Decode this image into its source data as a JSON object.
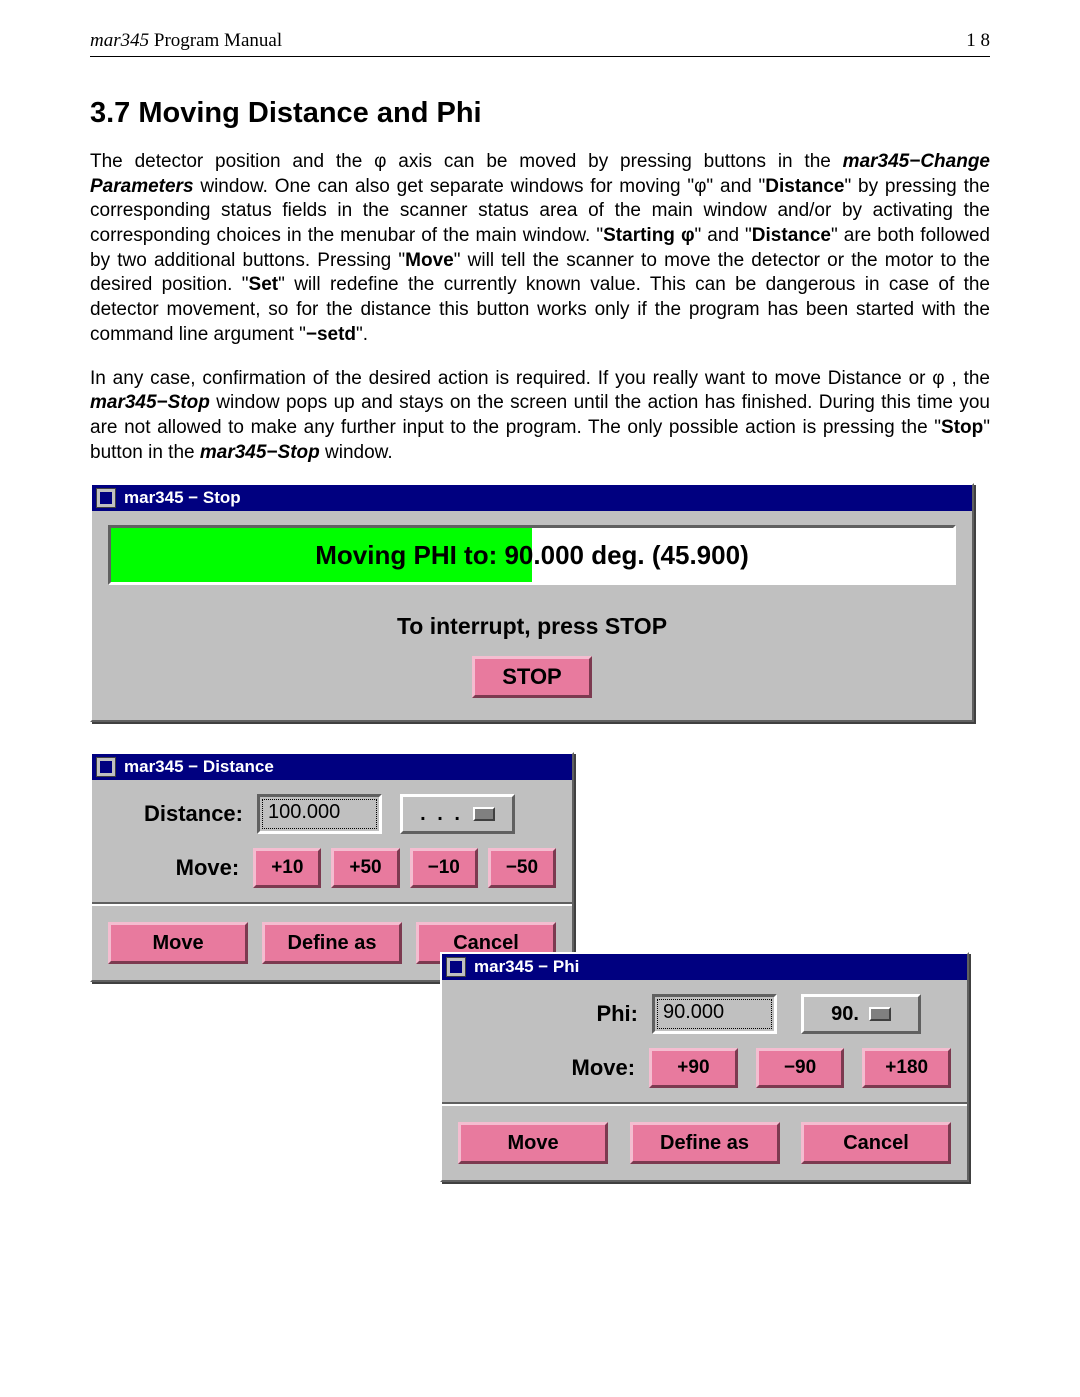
{
  "header": {
    "product": "mar345",
    "title_suffix": " Program Manual",
    "page_number": "1 8"
  },
  "section": {
    "heading": "3.7 Moving Distance and Phi"
  },
  "para1": {
    "t1": "The detector position and the φ axis can be moved by pressing buttons in the ",
    "bi1": "mar345−Change Parameters",
    "t2": " window. One can also get separate windows for moving \"φ\" and \"",
    "b1": "Distance",
    "t3": "\" by pressing the corresponding status fields in the scanner status area of the main  window and/or by activating the corresponding choices in the menubar of the main window. \"",
    "b2": "Starting φ",
    "t4": "\" and \"",
    "b3": "Distance",
    "t5": "\" are both followed by two additional buttons. Pressing \"",
    "b4": "Move",
    "t6": "\" will tell the scanner to move the detector or the motor to the desired position. \"",
    "b5": "Set",
    "t7": "\" will redefine the currently known value. This can be dangerous in case of the detector movement, so for the distance this button works only if the program has been started with the command line argument \"",
    "b6": "−setd",
    "t8": "\"."
  },
  "para2": {
    "t1": "In any case, confirmation of the desired action is required. If you really want to move Distance or φ , the ",
    "bi1": "mar345−Stop",
    "t2": " window pops up and stays on the screen until the action has finished. During this time you are not allowed to make any further input to the program. The only possible action is pressing the \"",
    "b1": "Stop",
    "t3": "\" button in the ",
    "bi2": "mar345−Stop",
    "t4": " window."
  },
  "stop_window": {
    "title": "mar345 − Stop",
    "progress_text": "Moving PHI to: 90.000  deg.  (45.900)",
    "instruction": "To interrupt, press STOP",
    "button": "STOP"
  },
  "distance_window": {
    "title": "mar345 − Distance",
    "label_distance": "Distance:",
    "value": "100.000",
    "dropdown_label": ". . .",
    "label_move": "Move:",
    "steps": [
      "+10",
      "+50",
      "−10",
      "−50"
    ],
    "btn_move": "Move",
    "btn_define": "Define as",
    "btn_cancel": "Cancel"
  },
  "phi_window": {
    "title": "mar345 − Phi",
    "label_phi": "Phi:",
    "value": "90.000",
    "dropdown_label": "90.",
    "label_move": "Move:",
    "steps": [
      "+90",
      "−90",
      "+180"
    ],
    "btn_move": "Move",
    "btn_define": "Define as",
    "btn_cancel": "Cancel"
  }
}
